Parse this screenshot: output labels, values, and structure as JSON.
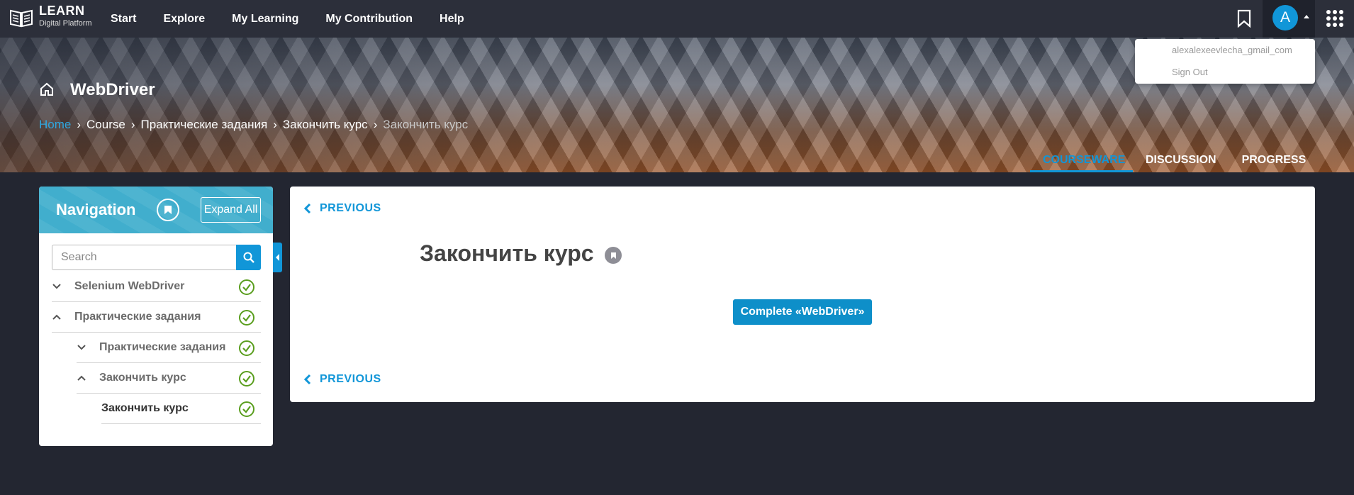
{
  "header": {
    "logo_title": "LEARN",
    "logo_subtitle": "Digital Platform",
    "nav_items": [
      "Start",
      "Explore",
      "My Learning",
      "My Contribution",
      "Help"
    ],
    "avatar_letter": "A",
    "icons": [
      "bookmark-icon",
      "caret-up-icon",
      "apps-grid-icon"
    ]
  },
  "user_menu": {
    "username": "alexalexeevlecha_gmail_com",
    "sign_out": "Sign Out"
  },
  "course": {
    "title": "WebDriver",
    "breadcrumb": [
      "Home",
      "Course",
      "Практические задания",
      "Закончить курс",
      "Закончить курс"
    ],
    "tabs": [
      "COURSEWARE",
      "DISCUSSION",
      "PROGRESS"
    ],
    "active_tab": "COURSEWARE"
  },
  "navigation": {
    "title": "Navigation",
    "expand_all": "Expand All",
    "search_placeholder": "Search",
    "items": [
      {
        "label": "Selenium WebDriver",
        "level": 0,
        "expanded": false,
        "completed": true
      },
      {
        "label": "Практические задания",
        "level": 0,
        "expanded": true,
        "completed": true
      },
      {
        "label": "Практические задания",
        "level": 1,
        "expanded": false,
        "completed": true
      },
      {
        "label": "Закончить курс",
        "level": 1,
        "expanded": true,
        "completed": true
      },
      {
        "label": "Закончить курс",
        "level": 2,
        "completed": true,
        "current": true
      }
    ]
  },
  "content": {
    "previous_label": "PREVIOUS",
    "unit_title": "Закончить курс",
    "complete_button": "Complete  «WebDriver»"
  },
  "colors": {
    "accent": "#1196d8",
    "topbar": "#2c2f3a",
    "background": "#232631",
    "nav_header": "#41aecd",
    "check": "#5a9e1e"
  }
}
